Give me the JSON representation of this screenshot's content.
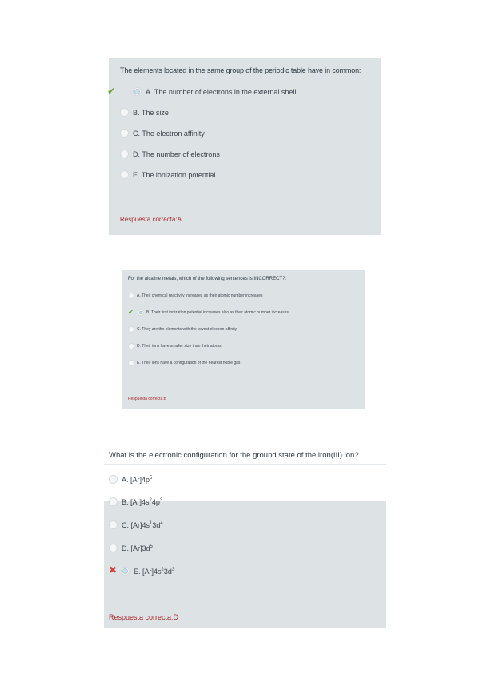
{
  "card1": {
    "question": "The elements located in the same group of the periodic table have in common:",
    "options": [
      "A. The number of electrons in the external shell",
      "B. The size",
      "C. The electron affinity",
      "D. The number of electrons",
      "E. The ionization potential"
    ],
    "selected_index": 0,
    "result_icon": "check-icon",
    "answer": "Respuesta correcta:A"
  },
  "card2": {
    "question": "For the alcaline metals, which of the following sentences is INCORRECT?:",
    "options": [
      "A. Their chemical reactivity increases as their atomic number increases",
      "B. Their first ionization potential increases also as their atomic number increases.",
      "C. They are the elements with the lowest electron affinity",
      "D. Their ions have smaller size than their atoms.",
      "E. Their ions have a configuration of the nearest noble gas"
    ],
    "selected_index": 1,
    "result_icon": "check-icon",
    "answer": "Respuesta correcta:B"
  },
  "card3": {
    "question": "What is the electronic configuration for the ground state of the iron(III) ion?",
    "options": [
      {
        "label": "A. [Ar]4p",
        "sup": "5",
        "rest": "",
        "sup2": ""
      },
      {
        "label": "B. [Ar]4s",
        "sup": "2",
        "rest": "4p",
        "sup2": "3"
      },
      {
        "label": "C. [Ar]4s",
        "sup": "1",
        "rest": "3d",
        "sup2": "4"
      },
      {
        "label": "D. [Ar]3d",
        "sup": "5",
        "rest": "",
        "sup2": ""
      },
      {
        "label": "E. [Ar]4s",
        "sup": "2",
        "rest": "3d",
        "sup2": "3"
      }
    ],
    "selected_index": 4,
    "result_icon": "cross-icon",
    "answer": "Respuesta correcta:D"
  }
}
